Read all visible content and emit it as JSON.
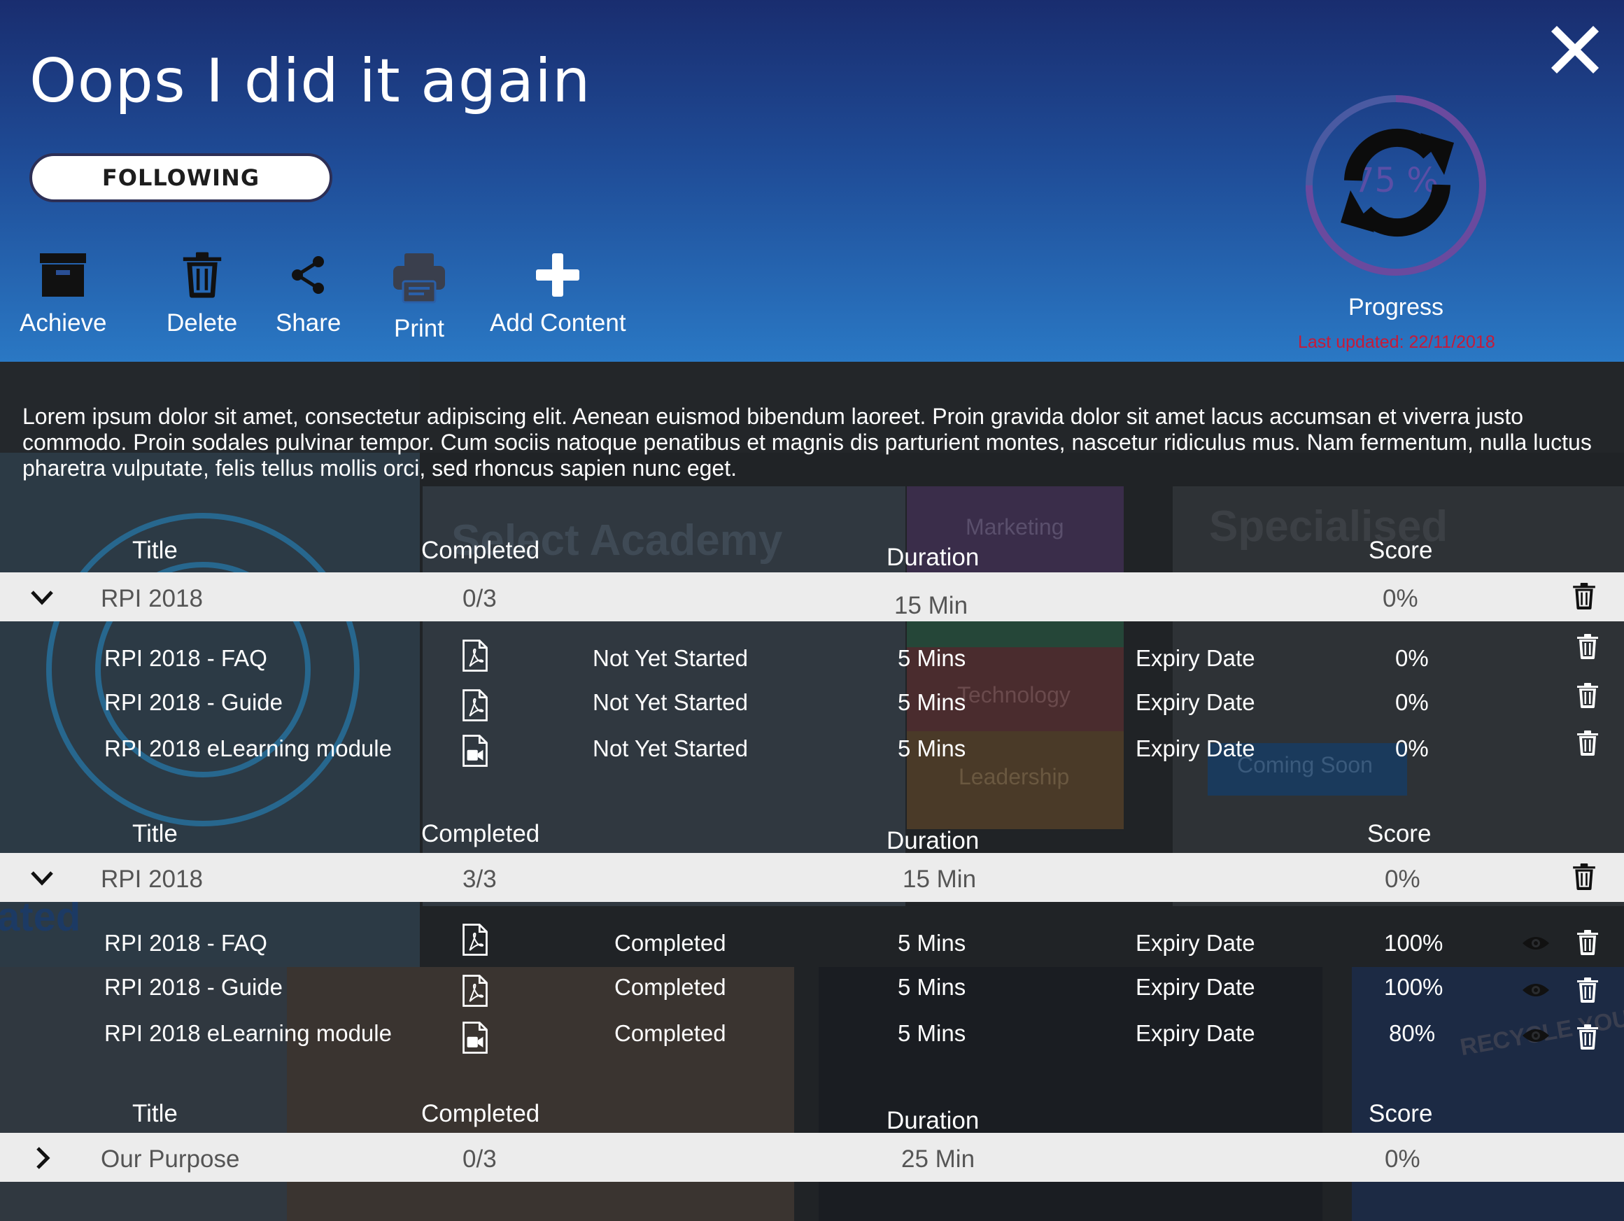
{
  "header": {
    "title": "Oops I did it again",
    "follow_label": "FOLLOWING",
    "toolbar": [
      {
        "label": "Achieve",
        "icon": "archive-box-icon"
      },
      {
        "label": "Delete",
        "icon": "trash-icon"
      },
      {
        "label": "Share",
        "icon": "share-icon"
      },
      {
        "label": "Print",
        "icon": "printer-icon"
      },
      {
        "label": "Add Content",
        "icon": "plus-icon"
      }
    ],
    "progress": {
      "percent_text": "75 %",
      "percent": 75,
      "label": "Progress",
      "last_updated": "Last updated: 22/11/2018"
    }
  },
  "description": "Lorem ipsum dolor sit amet, consectetur adipiscing elit. Aenean euismod bibendum laoreet. Proin gravida dolor sit amet lacus accumsan et viverra justo commodo. Proin sodales pulvinar tempor. Cum sociis natoque penatibus et magnis dis parturient montes, nascetur ridiculus mus. Nam fermentum, nulla luctus pharetra vulputate, felis tellus mollis orci, sed rhoncus sapien nunc eget.",
  "columns": {
    "title": "Title",
    "completed": "Completed",
    "duration": "Duration",
    "score": "Score"
  },
  "background": {
    "banner1": "Select  Academy",
    "banner2": "Specialised",
    "tile_marketing": "Marketing",
    "tile_technology": "Technology",
    "tile_leadership": "Leadership",
    "coming_soon": "Coming Soon",
    "fragment_ated": "ated",
    "fragment_recycle": "RECYCLE YOUR O"
  },
  "groups": [
    {
      "name": "RPI 2018",
      "completed": "0/3",
      "duration": "15 Min",
      "score": "0%",
      "expanded": true,
      "items": [
        {
          "title": "RPI 2018 - FAQ",
          "type": "pdf-icon",
          "status": "Not Yet Started",
          "duration": "5 Mins",
          "expiry": "Expiry Date",
          "score": "0%"
        },
        {
          "title": "RPI 2018 - Guide",
          "type": "pdf-icon",
          "status": "Not Yet Started",
          "duration": "5 Mins",
          "expiry": "Expiry Date",
          "score": "0%"
        },
        {
          "title": "RPI 2018 eLearning module",
          "type": "video-file-icon",
          "status": "Not Yet Started",
          "duration": "5 Mins",
          "expiry": "Expiry Date",
          "score": "0%"
        }
      ]
    },
    {
      "name": "RPI 2018",
      "completed": "3/3",
      "duration": "15 Min",
      "score": "0%",
      "expanded": true,
      "items": [
        {
          "title": "RPI 2018 - FAQ",
          "type": "pdf-icon",
          "status": "Completed",
          "duration": "5 Mins",
          "expiry": "Expiry Date",
          "score": "100%"
        },
        {
          "title": "RPI 2018 - Guide",
          "type": "pdf-icon",
          "status": "Completed",
          "duration": "5 Mins",
          "expiry": "Expiry Date",
          "score": "100%"
        },
        {
          "title": "RPI 2018 eLearning module",
          "type": "video-file-icon",
          "status": "Completed",
          "duration": "5 Mins",
          "expiry": "Expiry Date",
          "score": "80%"
        }
      ]
    },
    {
      "name": "Our Purpose",
      "completed": "0/3",
      "duration": "25 Min",
      "score": "0%",
      "expanded": false,
      "items": []
    }
  ],
  "colors": {
    "header_top": "#192d6f",
    "header_bottom": "#2a78c4",
    "accent_red": "#c71a38",
    "row_bg": "#ececec",
    "panel_bg": "#27292c"
  }
}
